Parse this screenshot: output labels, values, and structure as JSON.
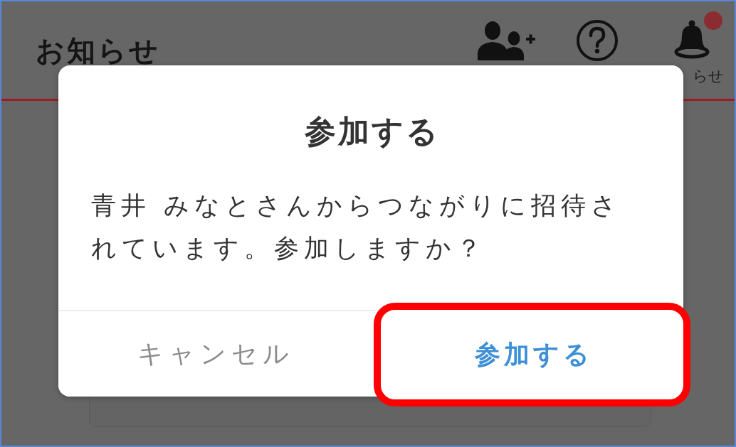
{
  "header": {
    "title": "お知らせ",
    "actions": [
      {
        "kind": "add-user"
      },
      {
        "kind": "help"
      },
      {
        "kind": "notifications",
        "badge": true,
        "label": "らせ"
      }
    ]
  },
  "dialog": {
    "title": "参加する",
    "message": "青井 みなとさんからつながりに招待されています。参加しますか？",
    "buttons": [
      {
        "label": "キャンセル",
        "kind": "cancel",
        "highlighted": false
      },
      {
        "label": "参加する",
        "kind": "confirm",
        "highlighted": true
      }
    ]
  }
}
